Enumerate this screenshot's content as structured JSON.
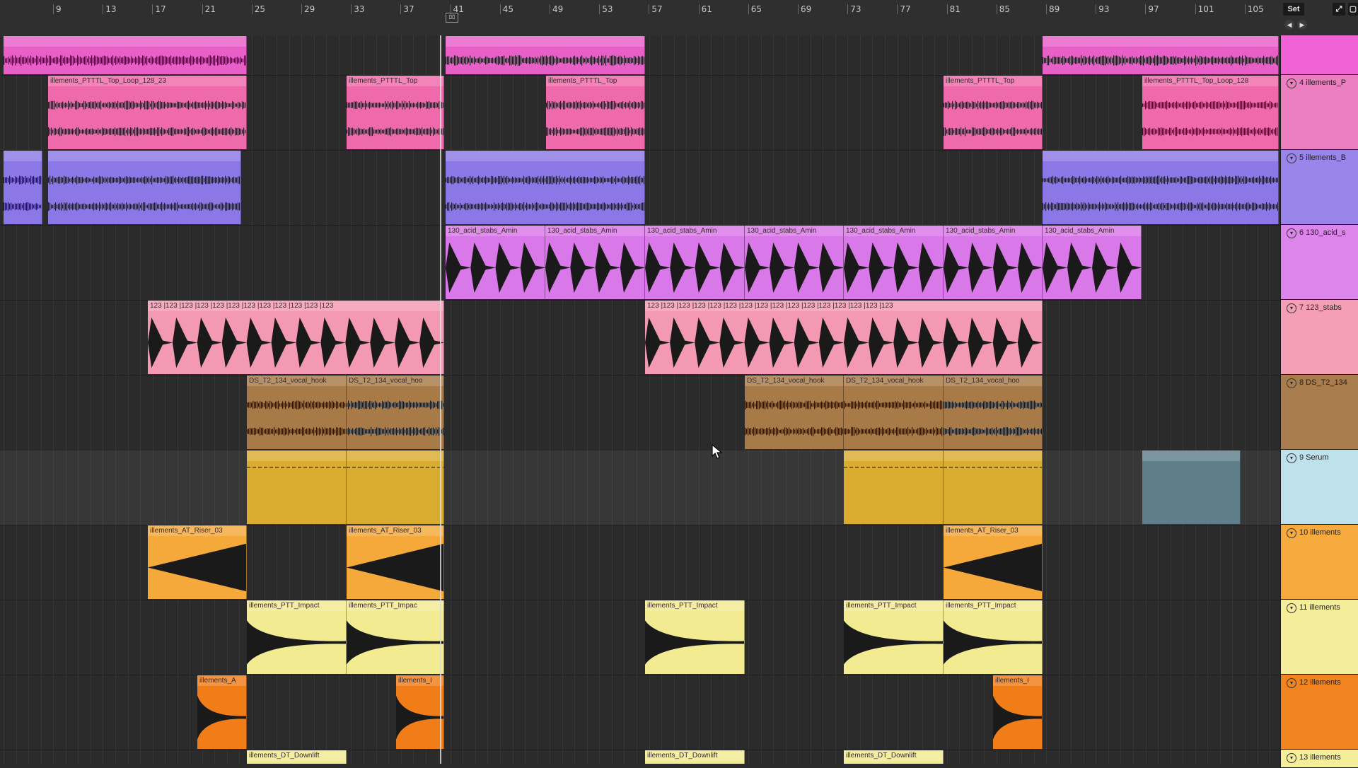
{
  "ruler": {
    "bars": [
      "9",
      "13",
      "17",
      "21",
      "25",
      "29",
      "33",
      "37",
      "41",
      "45",
      "49",
      "53",
      "57",
      "61",
      "65",
      "69",
      "73",
      "77",
      "81",
      "85",
      "89",
      "93",
      "97",
      "101",
      "105"
    ],
    "loop_marker": "⌧"
  },
  "top_right": {
    "set_label": "Set",
    "expand_icon": "⤢",
    "nav_left": "◀",
    "nav_right": "▶"
  },
  "colors": {
    "pink": "#e85fc8",
    "pink_dark": "#3a1432",
    "rose": "#ef6aab",
    "purple": "#8b78e6",
    "purple_dark": "#2b2450",
    "violet": "#d978e8",
    "salmon": "#f499b3",
    "brown": "#a87a48",
    "gold": "#d9ab2f",
    "orange": "#f5a93b",
    "yellow": "#f2eb92",
    "deep_orange": "#f07d18",
    "steel": "#5e7f8a",
    "lightblue": "#bde1ec"
  },
  "tracks": [
    {
      "name": "",
      "color": "pink",
      "header_color": "#f062d6",
      "clips": [
        {
          "start": 5,
          "end": 349,
          "label": ""
        },
        {
          "start": 630,
          "end": 912,
          "label": ""
        },
        {
          "start": 1474,
          "end": 1808,
          "label": ""
        }
      ]
    },
    {
      "name": "4 illements_P",
      "color": "rose",
      "header_color": "#ec7fbf",
      "clips": [
        {
          "start": 68,
          "end": 349,
          "label": "illements_PTTTL_Top_Loop_128_23"
        },
        {
          "start": 490,
          "end": 628,
          "label": "illements_PTTTL_Top"
        },
        {
          "start": 772,
          "end": 912,
          "label": "illements_PTTTL_Top"
        },
        {
          "start": 1334,
          "end": 1474,
          "label": "illements_PTTTL_Top"
        },
        {
          "start": 1615,
          "end": 1808,
          "label": "illements_PTTTL_Top_Loop_128"
        }
      ]
    },
    {
      "name": "5 illements_B",
      "color": "purple",
      "header_color": "#9a86ea",
      "clips": [
        {
          "start": 5,
          "end": 60,
          "label": ""
        },
        {
          "start": 68,
          "end": 341,
          "label": ""
        },
        {
          "start": 630,
          "end": 912,
          "label": ""
        },
        {
          "start": 1474,
          "end": 1808,
          "label": ""
        }
      ]
    },
    {
      "name": "6 130_acid_s",
      "color": "violet",
      "header_color": "#dc85ea",
      "clips": [
        {
          "start": 630,
          "end": 771,
          "label": "130_acid_stabs_Amin"
        },
        {
          "start": 771,
          "end": 912,
          "label": "130_acid_stabs_Amin"
        },
        {
          "start": 912,
          "end": 1053,
          "label": "130_acid_stabs_Amin"
        },
        {
          "start": 1053,
          "end": 1193,
          "label": "130_acid_stabs_Amin"
        },
        {
          "start": 1193,
          "end": 1334,
          "label": "130_acid_stabs_Amin"
        },
        {
          "start": 1334,
          "end": 1474,
          "label": "130_acid_stabs_Amin"
        },
        {
          "start": 1474,
          "end": 1614,
          "label": "130_acid_stabs_Amin"
        }
      ]
    },
    {
      "name": "7 123_stabs",
      "color": "salmon",
      "header_color": "#f59fb6",
      "clips": [
        {
          "start": 209,
          "end": 628,
          "label": "123 |123 |123 |123 |123 |123 |123 |123 |123 |123 |123 |123"
        },
        {
          "start": 912,
          "end": 1474,
          "label": "123 |123 |123 |123 |123 |123 |123 |123 |123 |123 |123 |123 |123 |123 |123 |123"
        }
      ]
    },
    {
      "name": "8 DS_T2_134",
      "color": "brown",
      "header_color": "#a97d4d",
      "clips": [
        {
          "start": 349,
          "end": 490,
          "label": "DS_T2_134_vocal_hook"
        },
        {
          "start": 490,
          "end": 628,
          "label": "DS_T2_134_vocal_hoo"
        },
        {
          "start": 1053,
          "end": 1193,
          "label": "DS_T2_134_vocal_hook"
        },
        {
          "start": 1193,
          "end": 1334,
          "label": "DS_T2_134_vocal_hook"
        },
        {
          "start": 1334,
          "end": 1474,
          "label": "DS_T2_134_vocal_hoo"
        }
      ]
    },
    {
      "name": "9 Serum",
      "color": "gold",
      "header_color": "#bfe1ec",
      "clips": [
        {
          "start": 349,
          "end": 490,
          "label": ""
        },
        {
          "start": 490,
          "end": 628,
          "label": ""
        },
        {
          "start": 1193,
          "end": 1334,
          "label": ""
        },
        {
          "start": 1334,
          "end": 1474,
          "label": ""
        },
        {
          "start": 1615,
          "end": 1754,
          "label": "",
          "color": "steel"
        }
      ]
    },
    {
      "name": "10 illements",
      "color": "orange",
      "header_color": "#f7ab3f",
      "clips": [
        {
          "start": 209,
          "end": 349,
          "label": "illements_AT_Riser_03"
        },
        {
          "start": 490,
          "end": 628,
          "label": "illements_AT_Riser_03"
        },
        {
          "start": 1334,
          "end": 1474,
          "label": "illements_AT_Riser_03"
        }
      ]
    },
    {
      "name": "11 illements",
      "color": "yellow",
      "header_color": "#f4ee9a",
      "clips": [
        {
          "start": 349,
          "end": 490,
          "label": "illements_PTT_Impact"
        },
        {
          "start": 490,
          "end": 628,
          "label": "illements_PTT_Impac"
        },
        {
          "start": 912,
          "end": 1053,
          "label": "illements_PTT_Impact"
        },
        {
          "start": 1193,
          "end": 1334,
          "label": "illements_PTT_Impact"
        },
        {
          "start": 1334,
          "end": 1474,
          "label": "illements_PTT_Impact"
        }
      ]
    },
    {
      "name": "12 illements",
      "color": "deep_orange",
      "header_color": "#f28420",
      "clips": [
        {
          "start": 279,
          "end": 349,
          "label": "illements_A"
        },
        {
          "start": 560,
          "end": 628,
          "label": "illements_I"
        },
        {
          "start": 1404,
          "end": 1474,
          "label": "illements_I"
        }
      ]
    },
    {
      "name": "13 illements",
      "color": "yellow",
      "header_color": "#f4ee9a",
      "clips": [
        {
          "start": 349,
          "end": 490,
          "label": "illements_DT_Downlift"
        },
        {
          "start": 912,
          "end": 1053,
          "label": "illements_DT_Downlift"
        },
        {
          "start": 1193,
          "end": 1334,
          "label": "illements_DT_Downlift"
        }
      ]
    }
  ]
}
